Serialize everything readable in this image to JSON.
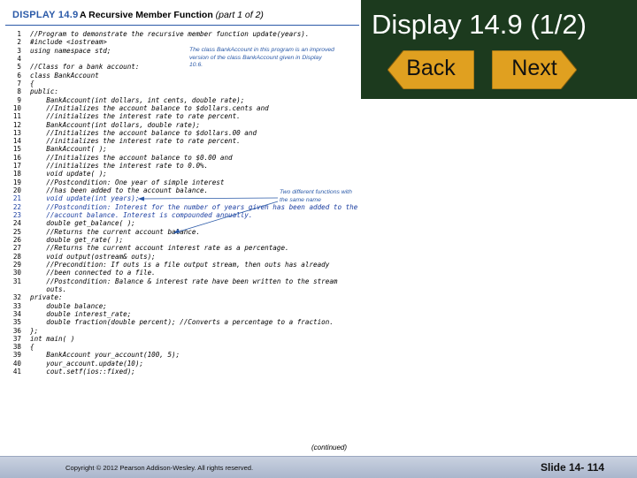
{
  "display": {
    "number": "DISPLAY 14.9",
    "title": "A Recursive Member Function",
    "part": "(part 1 of 2)"
  },
  "code_lines": [
    {
      "n": "1",
      "t": "//Program to demonstrate the recursive member function update(years)."
    },
    {
      "n": "2",
      "t": "#include <iostream>"
    },
    {
      "n": "3",
      "t": "using namespace std;"
    },
    {
      "n": "4",
      "t": ""
    },
    {
      "n": "5",
      "t": "//Class for a bank account:"
    },
    {
      "n": "6",
      "t": "class BankAccount"
    },
    {
      "n": "7",
      "t": "{"
    },
    {
      "n": "8",
      "t": "public:"
    },
    {
      "n": "9",
      "t": "    BankAccount(int dollars, int cents, double rate);"
    },
    {
      "n": "10",
      "t": "    //Initializes the account balance to $dollars.cents and"
    },
    {
      "n": "11",
      "t": "    //initializes the interest rate to rate percent."
    },
    {
      "n": "12",
      "t": "    BankAccount(int dollars, double rate);"
    },
    {
      "n": "13",
      "t": "    //Initializes the account balance to $dollars.00 and"
    },
    {
      "n": "14",
      "t": "    //initializes the interest rate to rate percent."
    },
    {
      "n": "15",
      "t": "    BankAccount( );"
    },
    {
      "n": "16",
      "t": "    //Initializes the account balance to $0.00 and"
    },
    {
      "n": "17",
      "t": "    //initializes the interest rate to 0.0%."
    },
    {
      "n": "18",
      "t": "    void update( );"
    },
    {
      "n": "19",
      "t": "    //Postcondition: One year of simple interest"
    },
    {
      "n": "20",
      "t": "    //has been added to the account balance."
    },
    {
      "n": "21",
      "t": "    void update(int years);",
      "blue": true
    },
    {
      "n": "22",
      "t": "    //Postcondition: Interest for the number of years given has been added to the",
      "blue": true
    },
    {
      "n": "23",
      "t": "    //account balance. Interest is compounded annually.",
      "blue": true
    },
    {
      "n": "24",
      "t": "    double get_balance( );"
    },
    {
      "n": "25",
      "t": "    //Returns the current account balance."
    },
    {
      "n": "26",
      "t": "    double get_rate( );"
    },
    {
      "n": "27",
      "t": "    //Returns the current account interest rate as a percentage."
    },
    {
      "n": "28",
      "t": "    void output(ostream& outs);"
    },
    {
      "n": "29",
      "t": "    //Precondition: If outs is a file output stream, then outs has already"
    },
    {
      "n": "30",
      "t": "    //been connected to a file."
    },
    {
      "n": "31",
      "t": "    //Postcondition: Balance & interest rate have been written to the stream"
    },
    {
      "n": "",
      "t": "    outs."
    },
    {
      "n": "32",
      "t": "private:"
    },
    {
      "n": "33",
      "t": "    double balance;"
    },
    {
      "n": "34",
      "t": "    double interest_rate;"
    },
    {
      "n": "35",
      "t": "    double fraction(double percent); //Converts a percentage to a fraction."
    },
    {
      "n": "36",
      "t": "};"
    },
    {
      "n": "37",
      "t": "int main( )"
    },
    {
      "n": "38",
      "t": "{"
    },
    {
      "n": "39",
      "t": "    BankAccount your_account(100, 5);"
    },
    {
      "n": "40",
      "t": "    your_account.update(10);"
    },
    {
      "n": "41",
      "t": "    cout.setf(ios::fixed);"
    }
  ],
  "annotations": {
    "class_note": "The class BankAccount in this program is an improved version of the class BankAccount given in Display 10.6.",
    "functions_note": "Two different functions with the same name"
  },
  "continued": "(continued)",
  "slide_title": "Display 14.9  (1/2)",
  "nav": {
    "back_label": "Back",
    "next_label": "Next"
  },
  "footer": {
    "copyright": "Copyright © 2012 Pearson Addison-Wesley.  All rights reserved.",
    "slide_number": "Slide 14- 114"
  },
  "colors": {
    "header_bg": "#1c3a1e",
    "button_fill": "#e0a020",
    "code_blue": "#1a3da0",
    "footer_bg": "#b8c2d6"
  }
}
